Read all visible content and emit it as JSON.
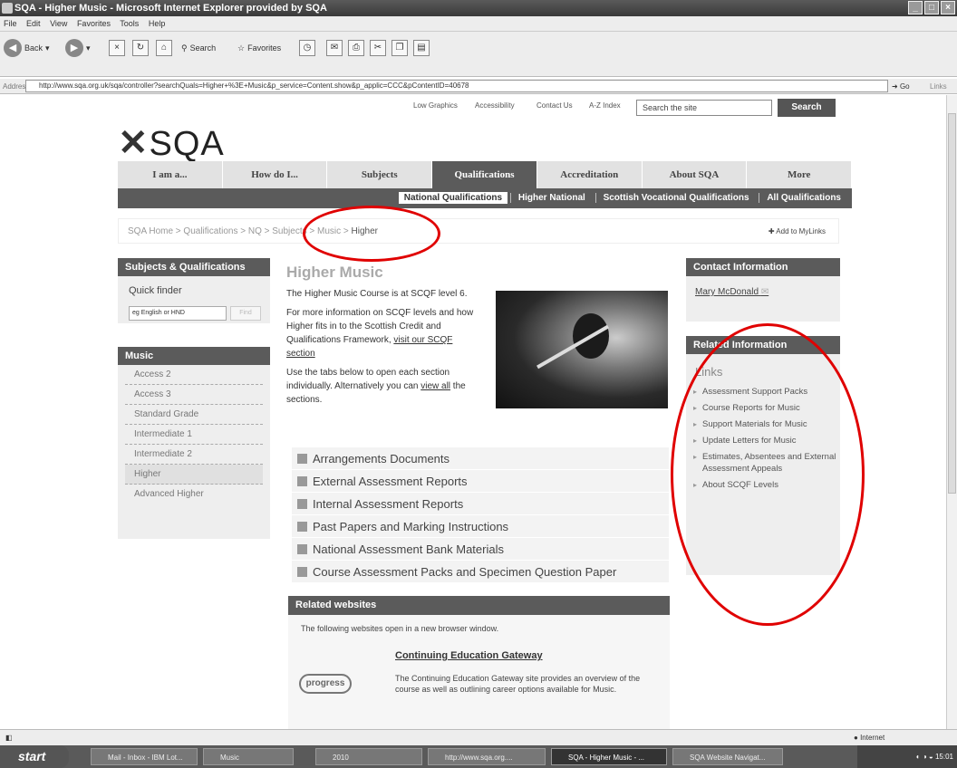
{
  "window": {
    "title": "SQA - Higher Music - Microsoft Internet Explorer provided by SQA"
  },
  "menu": [
    "File",
    "Edit",
    "View",
    "Favorites",
    "Tools",
    "Help"
  ],
  "toolbar": {
    "back": "Back",
    "search": "Search",
    "favorites": "Favorites"
  },
  "address": {
    "label": "Address",
    "url": "http://www.sqa.org.uk/sqa/controller?searchQuals=Higher+%3E+Music&p_service=Content.show&p_applic=CCC&pContentID=40678",
    "go": "Go",
    "links": "Links"
  },
  "header": {
    "util": [
      "Low Graphics",
      "Accessibility",
      "Contact Us",
      "A-Z Index"
    ],
    "search_placeholder": "Search the site",
    "search_button": "Search",
    "logo": "SQA"
  },
  "nav": [
    "I am a...",
    "How do I...",
    "Subjects",
    "Qualifications",
    "Accreditation",
    "About SQA",
    "More"
  ],
  "subnav": [
    "National Qualifications",
    "Higher National",
    "Scottish Vocational Qualifications",
    "All Qualifications"
  ],
  "breadcrumb": {
    "path": "SQA Home > Qualifications > NQ > Subjects > Music > ",
    "current": "Higher",
    "mylinks": "Add to MyLinks"
  },
  "left": {
    "subjects_title": "Subjects & Qualifications",
    "quick_finder": "Quick finder",
    "qf_placeholder": "eg English or HND",
    "qf_button": "Find",
    "music_title": "Music",
    "music_items": [
      "Access 2",
      "Access 3",
      "Standard Grade",
      "Intermediate 1",
      "Intermediate 2",
      "Higher",
      "Advanced Higher"
    ]
  },
  "main": {
    "title": "Higher Music",
    "p1": "The Higher Music Course is at SCQF level 6.",
    "p2a": "For more information on SCQF levels and how Higher fits in to the Scottish Credit and Qualifications Framework, ",
    "p2link": "visit our SCQF section",
    "p3a": "Use the tabs below to open each section individually. Alternatively you can ",
    "p3link": "view all",
    "p3b": " the sections.",
    "tabs": [
      "Arrangements Documents",
      "External Assessment Reports",
      "Internal Assessment Reports",
      "Past Papers and Marking Instructions",
      "National Assessment Bank Materials",
      "Course Assessment Packs and Specimen Question Paper"
    ]
  },
  "related_websites": {
    "title": "Related websites",
    "intro": "The following websites open in a new browser window.",
    "link": "Continuing Education Gateway",
    "desc": "The Continuing Education Gateway site provides an overview of the course as well as outlining career options available for Music.",
    "logo": "progress"
  },
  "right": {
    "contact_title": "Contact Information",
    "contact_name": "Mary McDonald",
    "related_title": "Related Information",
    "links_heading": "Links",
    "links": [
      "Assessment Support Packs",
      "Course Reports for Music",
      "Support Materials for Music",
      "Update Letters for Music",
      "Estimates, Absentees and External Assessment Appeals",
      "About SCQF Levels"
    ]
  },
  "status": {
    "zone": "Internet"
  },
  "taskbar": {
    "start": "start",
    "tasks": [
      "Mail - Inbox - IBM Lot...",
      "Music",
      "2010",
      "http://www.sqa.org....",
      "SQA - Higher Music - ...",
      "SQA Website Navigat..."
    ],
    "clock": "15:01"
  }
}
